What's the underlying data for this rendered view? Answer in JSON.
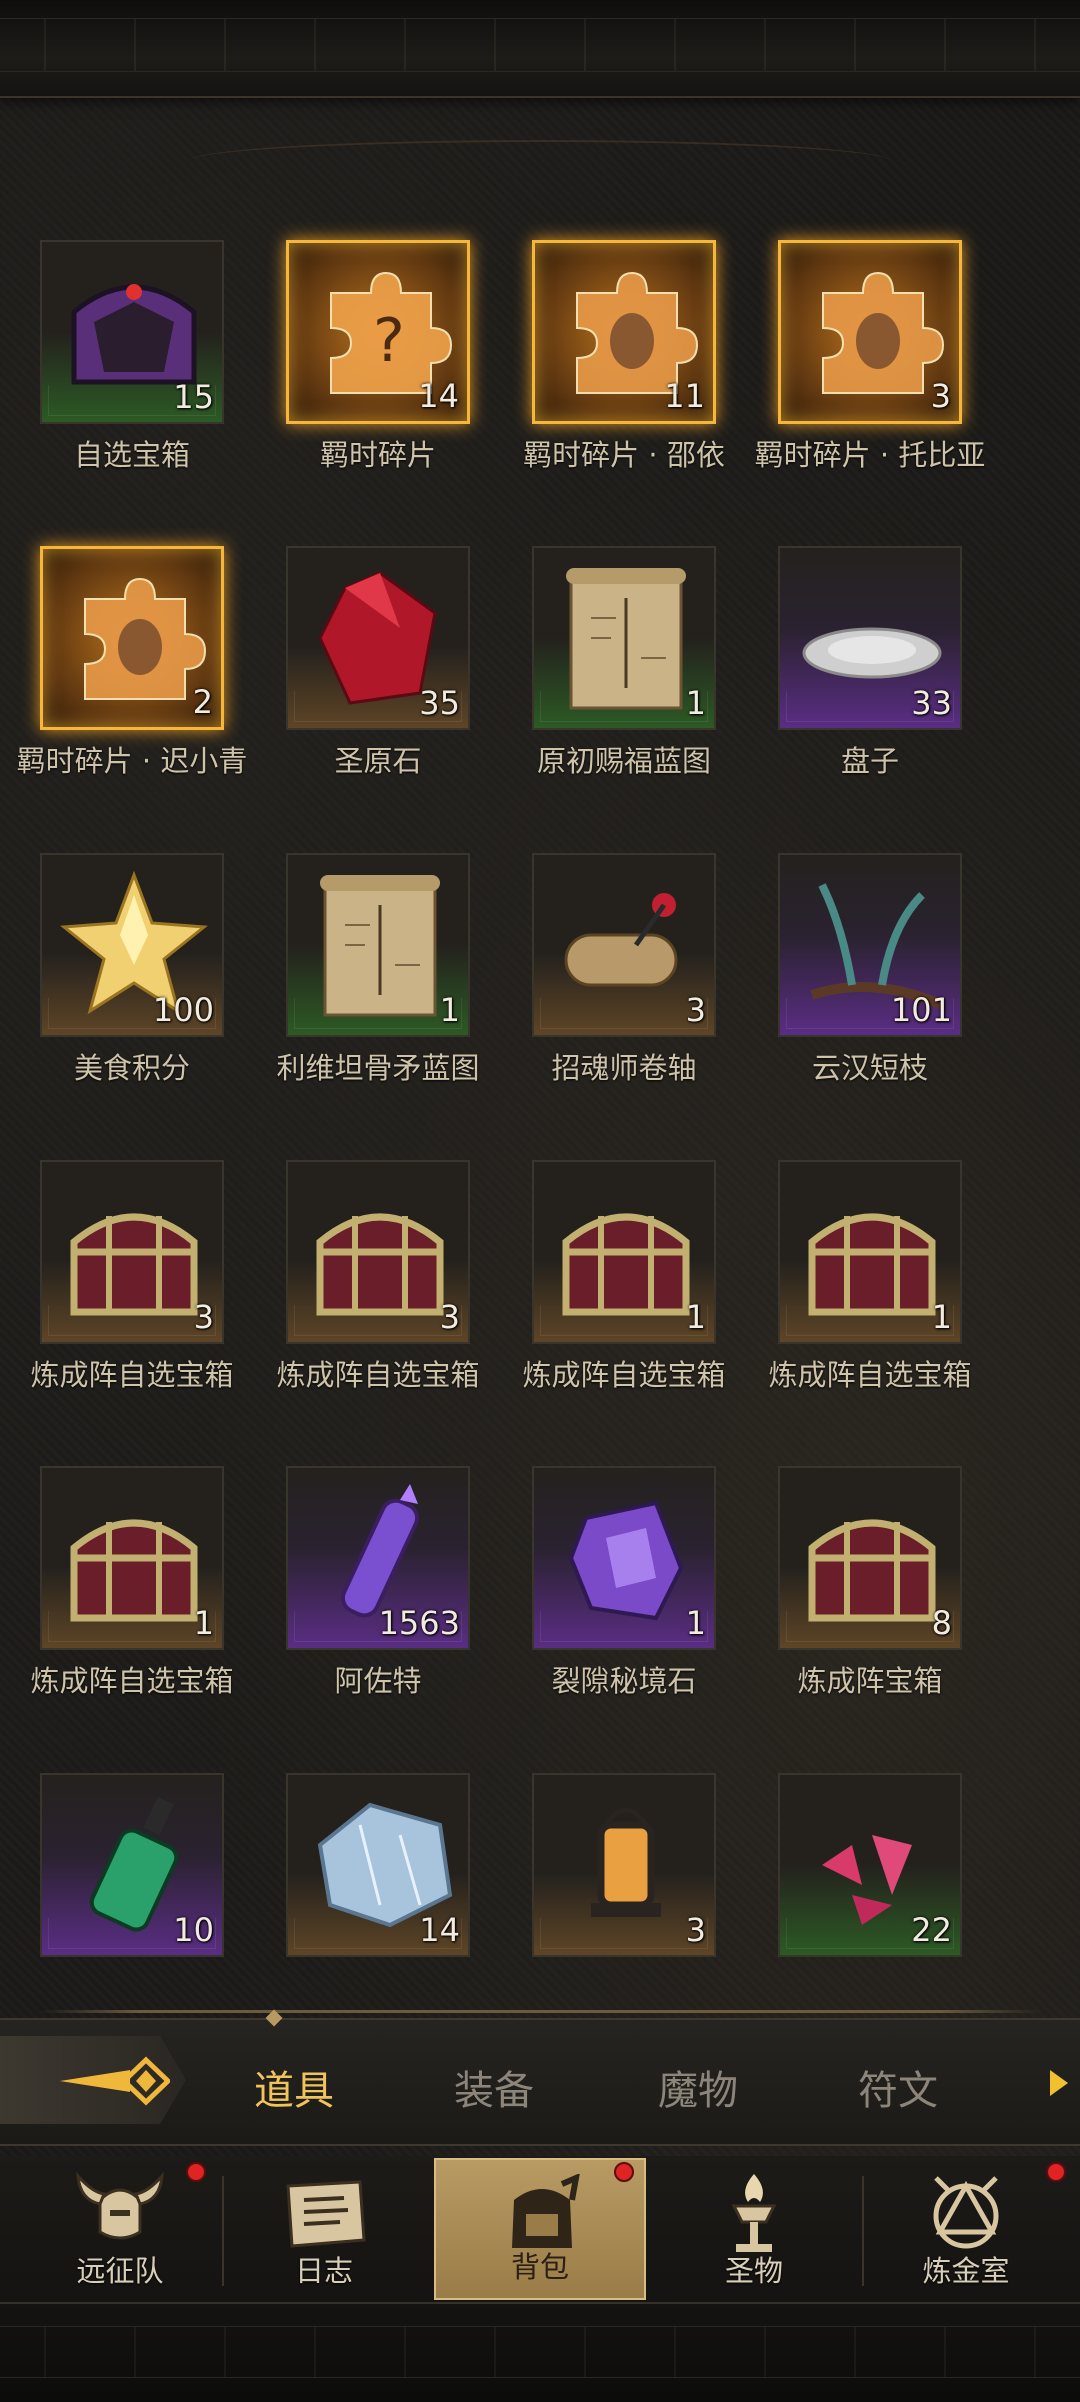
{
  "items": [
    {
      "name": "自选宝箱",
      "count": "15",
      "rarity": "green",
      "icon": "purple-chest-icon"
    },
    {
      "name": "羁时碎片",
      "count": "14",
      "rarity": "gold",
      "icon": "puzzle-question-icon"
    },
    {
      "name": "羁时碎片 · 邵依",
      "count": "11",
      "rarity": "gold",
      "icon": "puzzle-portrait-icon"
    },
    {
      "name": "羁时碎片 · 托比亚",
      "count": "3",
      "rarity": "gold",
      "icon": "puzzle-portrait-icon"
    },
    {
      "name": "羁时碎片 · 迟小青",
      "count": "2",
      "rarity": "gold",
      "icon": "puzzle-portrait-icon"
    },
    {
      "name": "圣原石",
      "count": "35",
      "rarity": "brown",
      "icon": "red-gem-icon"
    },
    {
      "name": "原初赐福蓝图",
      "count": "1",
      "rarity": "green",
      "icon": "scroll-blueprint-icon"
    },
    {
      "name": "盘子",
      "count": "33",
      "rarity": "purple",
      "icon": "plate-icon"
    },
    {
      "name": "美食积分",
      "count": "100",
      "rarity": "brown",
      "icon": "gold-star-icon"
    },
    {
      "name": "利维坦骨矛蓝图",
      "count": "1",
      "rarity": "green",
      "icon": "scroll-blueprint-icon"
    },
    {
      "name": "招魂师卷轴",
      "count": "3",
      "rarity": "brown",
      "icon": "rolled-scroll-icon"
    },
    {
      "name": "云汉短枝",
      "count": "101",
      "rarity": "purple",
      "icon": "branch-icon"
    },
    {
      "name": "炼成阵自选宝箱",
      "count": "3",
      "rarity": "brown",
      "icon": "chest-icon"
    },
    {
      "name": "炼成阵自选宝箱",
      "count": "3",
      "rarity": "brown",
      "icon": "chest-icon"
    },
    {
      "name": "炼成阵自选宝箱",
      "count": "1",
      "rarity": "brown",
      "icon": "chest-icon"
    },
    {
      "name": "炼成阵自选宝箱",
      "count": "1",
      "rarity": "brown",
      "icon": "chest-icon"
    },
    {
      "name": "炼成阵自选宝箱",
      "count": "1",
      "rarity": "brown",
      "icon": "chest-icon"
    },
    {
      "name": "阿佐特",
      "count": "1563",
      "rarity": "purple",
      "icon": "potion-vial-icon"
    },
    {
      "name": "裂隙秘境石",
      "count": "1",
      "rarity": "purple",
      "icon": "purple-crystal-icon"
    },
    {
      "name": "炼成阵宝箱",
      "count": "8",
      "rarity": "brown",
      "icon": "chest-icon"
    },
    {
      "name": "",
      "count": "10",
      "rarity": "purple",
      "icon": "green-potion-icon"
    },
    {
      "name": "",
      "count": "14",
      "rarity": "brown",
      "icon": "ice-stone-icon"
    },
    {
      "name": "",
      "count": "3",
      "rarity": "brown",
      "icon": "lantern-icon"
    },
    {
      "name": "",
      "count": "22",
      "rarity": "green",
      "icon": "pink-shards-icon"
    }
  ],
  "tabs": {
    "items_label": "道具",
    "equipment_label": "装备",
    "monsters_label": "魔物",
    "runes_label": "符文"
  },
  "nav": {
    "expedition_label": "远征队",
    "journal_label": "日志",
    "backpack_label": "背包",
    "relics_label": "圣物",
    "alchemy_label": "炼金室"
  },
  "colors": {
    "accent_gold": "#f0c45a",
    "rarity_gold": "#f5b63a",
    "rarity_green": "#2c5a24",
    "rarity_purple": "#5a2d84",
    "rarity_brown": "#5e4526",
    "notify_red": "#e02424"
  }
}
